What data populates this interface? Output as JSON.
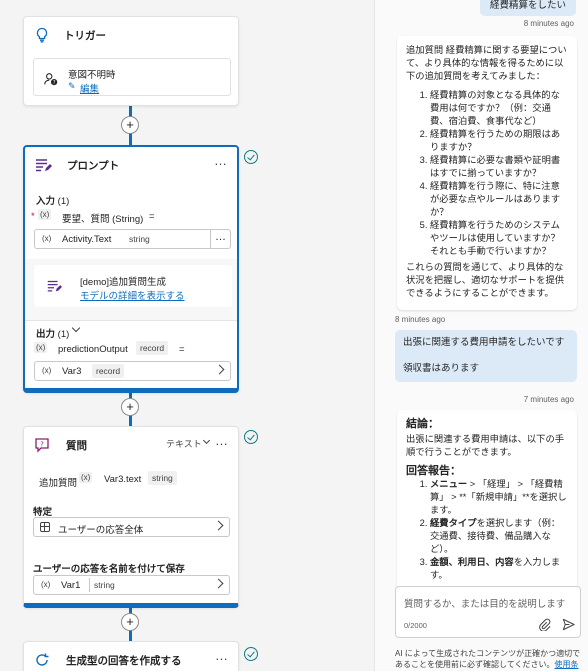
{
  "trigger": {
    "title": "トリガー",
    "item_name": "意図不明時",
    "edit_label": "編集"
  },
  "prompt": {
    "title": "プロンプト",
    "more": "…",
    "input_label": "入力",
    "input_count": "(1)",
    "required_mark": "*",
    "var_badge": "(x)",
    "param_name": "要望、質問 (String)",
    "equals": "=",
    "activity_value": "Activity.Text",
    "activity_type": "string",
    "demo_name": "[demo]追加質問生成",
    "details_link": "モデルの詳細を表示する",
    "output_label": "出力",
    "output_count": "(1)",
    "output_name": "predictionOutput",
    "output_type": "record",
    "var_name": "Var3",
    "var_type": "record"
  },
  "question": {
    "title": "質問",
    "mode": "テキスト",
    "prompt_label": "追加質問",
    "var_value": "Var3.text",
    "var_type": "string",
    "identify_label": "特定",
    "identify_value": "ユーザーの応答全体",
    "save_label": "ユーザーの応答を名前を付けて保存",
    "save_var": "Var1",
    "save_type": "string"
  },
  "generative": {
    "title": "生成型の回答を作成する"
  },
  "chat": {
    "user_msg_1": "経費精算をしたい",
    "ts_1": "8 minutes ago",
    "bot_intro": "追加質問 経費精算に関する要望について、より具体的な情報を得るために以下の追加質問を考えてみました：",
    "bot_questions": [
      "経費精算の対象となる具体的な費用は何ですか？（例：交通費、宿泊費、食事代など）",
      "経費精算を行うための期限はありますか？",
      "経費精算に必要な書類や証明書はすでに揃っていますか？",
      "経費精算を行う際に、特に注意が必要な点やルールはありますか？",
      "経費精算を行うためのシステムやツールは使用していますか？それとも手動で行いますか？"
    ],
    "bot_outro": "これらの質問を通じて、より具体的な状況を把握し、適切なサポートを提供できるようにすることができます。",
    "ts_2": "8 minutes ago",
    "user_msg_2a": "出張に関連する費用申請をしたいです",
    "user_msg_2b": "領収書はあります",
    "ts_3": "7 minutes ago",
    "conclusion_heading": "結論：",
    "conclusion_text": "出張に関連する費用申請は、以下の手順で行うことができます。",
    "answer_heading": "回答報告：",
    "answer_steps": [
      {
        "bold": "メニュー",
        "rest": " > 「経理」 > 「経費精算」 > **「新規申請」**を選択します。"
      },
      {
        "bold": "経費タイプ",
        "rest": "を選択します（例：交通費、接待費、備品購入など）。"
      },
      {
        "bold": "金額、利用日、内容",
        "rest": "を入力します。"
      }
    ],
    "input_placeholder": "質問するか、または目的を説明します",
    "char_count": "0/2000",
    "disclaimer": "AI によって生成されたコンテンツが正確かつ適切であることを使用前に必ず確認してください。",
    "terms_link": "使用条"
  }
}
